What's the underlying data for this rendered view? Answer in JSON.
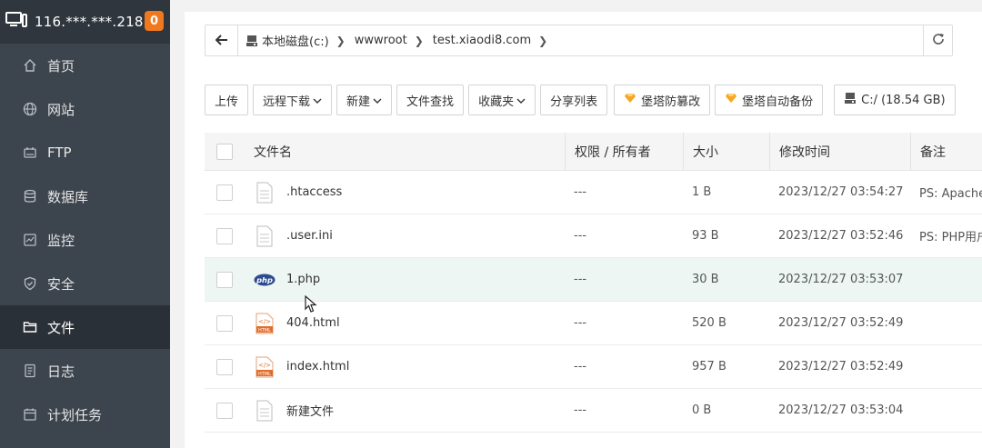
{
  "sidebar": {
    "host": "116.***.***.218",
    "badge": "0",
    "items": [
      {
        "label": "首页",
        "icon": "home-icon"
      },
      {
        "label": "网站",
        "icon": "globe-icon"
      },
      {
        "label": "FTP",
        "icon": "ftp-icon"
      },
      {
        "label": "数据库",
        "icon": "database-icon"
      },
      {
        "label": "监控",
        "icon": "monitor-icon"
      },
      {
        "label": "安全",
        "icon": "shield-icon"
      },
      {
        "label": "文件",
        "icon": "folder-icon",
        "active": true
      },
      {
        "label": "日志",
        "icon": "log-icon"
      },
      {
        "label": "计划任务",
        "icon": "calendar-icon"
      }
    ]
  },
  "path": {
    "crumbs": [
      "本地磁盘(c:)",
      "wwwroot",
      "test.xiaodi8.com"
    ]
  },
  "toolbar": {
    "upload": "上传",
    "remote_download": "远程下载",
    "new": "新建",
    "file_search": "文件查找",
    "favorites": "收藏夹",
    "share_list": "分享列表",
    "tamper_proof": "堡塔防篡改",
    "auto_backup": "堡塔自动备份",
    "disk": "C:/ (18.54 GB)"
  },
  "table": {
    "headers": {
      "name": "文件名",
      "perm": "权限 / 所有者",
      "size": "大小",
      "mtime": "修改时间",
      "note": "备注"
    },
    "rows": [
      {
        "name": ".htaccess",
        "perm": "---",
        "size": "1 B",
        "mtime": "2023/12/27 03:54:27",
        "note": "PS: Apache用",
        "type": "text"
      },
      {
        "name": ".user.ini",
        "perm": "---",
        "size": "93 B",
        "mtime": "2023/12/27 03:52:46",
        "note": "PS: PHP用户",
        "type": "text"
      },
      {
        "name": "1.php",
        "perm": "---",
        "size": "30 B",
        "mtime": "2023/12/27 03:53:07",
        "note": "",
        "type": "php"
      },
      {
        "name": "404.html",
        "perm": "---",
        "size": "520 B",
        "mtime": "2023/12/27 03:52:49",
        "note": "",
        "type": "html"
      },
      {
        "name": "index.html",
        "perm": "---",
        "size": "957 B",
        "mtime": "2023/12/27 03:52:49",
        "note": "",
        "type": "html"
      },
      {
        "name": "新建文件",
        "perm": "---",
        "size": "0 B",
        "mtime": "2023/12/27 03:53:04",
        "note": "",
        "type": "text"
      }
    ]
  },
  "colors": {
    "sidebar_bg": "#3c444d",
    "badge": "#f0781e",
    "row_highlight": "#eef6f3",
    "gem": "#f5a623"
  }
}
